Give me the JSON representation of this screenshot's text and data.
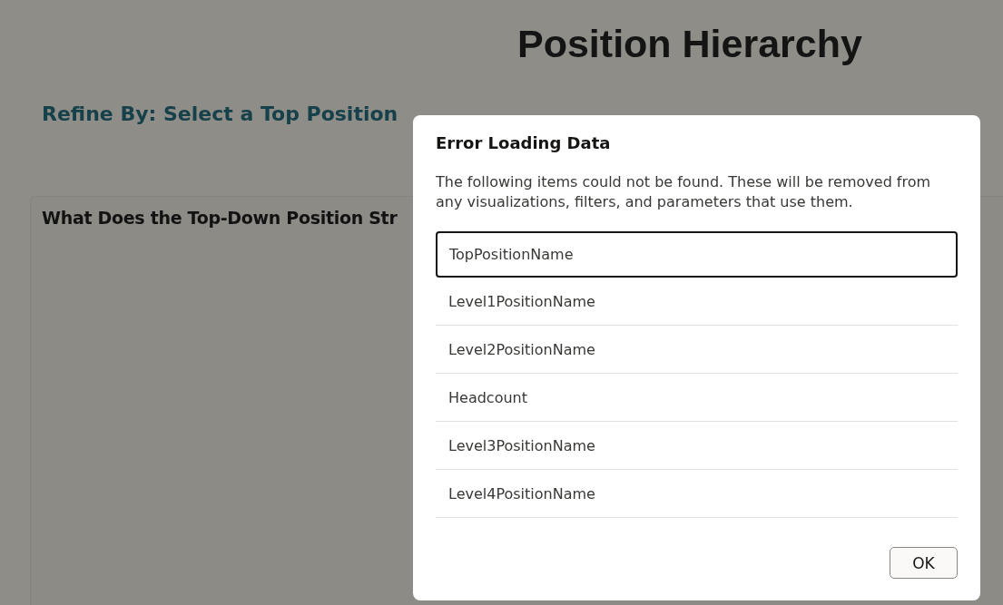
{
  "page": {
    "title": "Position Hierarchy",
    "filter_heading": "Refine By: Select a Top Position",
    "card_title": "What Does the Top-Down Position Str"
  },
  "dialog": {
    "title": "Error Loading Data",
    "message": "The following items could not be found. These will be removed from any visualizations, filters, and parameters that use them.",
    "items": [
      {
        "label": "TopPositionName",
        "selected": true
      },
      {
        "label": "Level1PositionName",
        "selected": false
      },
      {
        "label": "Level2PositionName",
        "selected": false
      },
      {
        "label": "Headcount",
        "selected": false
      },
      {
        "label": "Level3PositionName",
        "selected": false
      },
      {
        "label": "Level4PositionName",
        "selected": false
      }
    ],
    "buttons": [
      "OK"
    ]
  }
}
